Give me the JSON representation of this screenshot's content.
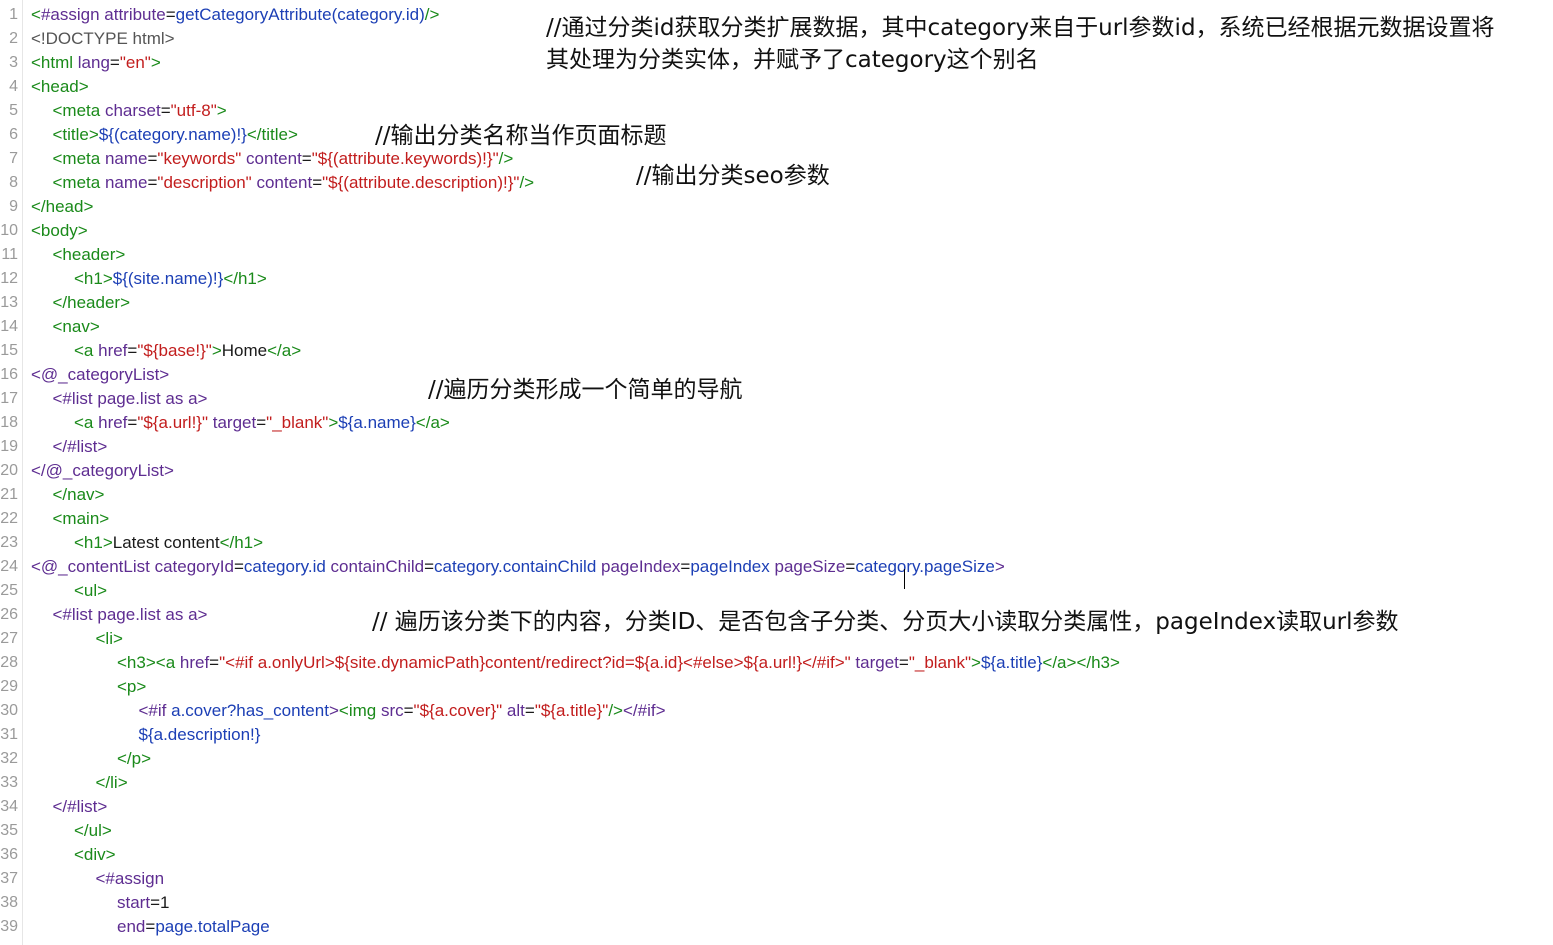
{
  "editor": {
    "lines": [
      {
        "n": "1",
        "indent": 0,
        "tokens": [
          [
            "<",
            "tag"
          ],
          [
            "#assign ",
            "attr"
          ],
          [
            "attribute",
            "attr"
          ],
          [
            "=",
            "txt"
          ],
          [
            "getCategoryAttribute(category.id)",
            "expr"
          ],
          [
            "/>",
            "tag"
          ]
        ]
      },
      {
        "n": "2",
        "indent": 0,
        "tokens": [
          [
            "<!DOCTYPE html>",
            "doc"
          ]
        ]
      },
      {
        "n": "3",
        "indent": 0,
        "tokens": [
          [
            "<html ",
            "tag"
          ],
          [
            "lang",
            "attr"
          ],
          [
            "=",
            "txt"
          ],
          [
            "\"en\"",
            "val"
          ],
          [
            ">",
            "tag"
          ]
        ]
      },
      {
        "n": "4",
        "indent": 0,
        "tokens": [
          [
            "<head>",
            "tag"
          ]
        ]
      },
      {
        "n": "5",
        "indent": 1,
        "tokens": [
          [
            "<meta ",
            "tag"
          ],
          [
            "charset",
            "attr"
          ],
          [
            "=",
            "txt"
          ],
          [
            "\"utf-8\"",
            "val"
          ],
          [
            ">",
            "tag"
          ]
        ]
      },
      {
        "n": "6",
        "indent": 1,
        "tokens": [
          [
            "<title>",
            "tag"
          ],
          [
            "${(category.name)!}",
            "expr"
          ],
          [
            "</title>",
            "tag"
          ]
        ]
      },
      {
        "n": "7",
        "indent": 1,
        "tokens": [
          [
            "<meta ",
            "tag"
          ],
          [
            "name",
            "attr"
          ],
          [
            "=",
            "txt"
          ],
          [
            "\"keywords\" ",
            "val"
          ],
          [
            "content",
            "attr"
          ],
          [
            "=",
            "txt"
          ],
          [
            "\"${(attribute.keywords)!}\"",
            "val"
          ],
          [
            "/>",
            "tag"
          ]
        ]
      },
      {
        "n": "8",
        "indent": 1,
        "tokens": [
          [
            "<meta ",
            "tag"
          ],
          [
            "name",
            "attr"
          ],
          [
            "=",
            "txt"
          ],
          [
            "\"description\" ",
            "val"
          ],
          [
            "content",
            "attr"
          ],
          [
            "=",
            "txt"
          ],
          [
            "\"${(attribute.description)!}\"",
            "val"
          ],
          [
            "/>",
            "tag"
          ]
        ]
      },
      {
        "n": "9",
        "indent": 0,
        "tokens": [
          [
            "</head>",
            "tag"
          ]
        ]
      },
      {
        "n": "10",
        "indent": 0,
        "tokens": [
          [
            "<body>",
            "tag"
          ]
        ]
      },
      {
        "n": "11",
        "indent": 1,
        "tokens": [
          [
            "<header>",
            "tag"
          ]
        ]
      },
      {
        "n": "12",
        "indent": 2,
        "tokens": [
          [
            "<h1>",
            "tag"
          ],
          [
            "${(site.name)!}",
            "expr"
          ],
          [
            "</h1>",
            "tag"
          ]
        ]
      },
      {
        "n": "13",
        "indent": 1,
        "tokens": [
          [
            "</header>",
            "tag"
          ]
        ]
      },
      {
        "n": "14",
        "indent": 1,
        "tokens": [
          [
            "<nav>",
            "tag"
          ]
        ]
      },
      {
        "n": "15",
        "indent": 2,
        "tokens": [
          [
            "<a ",
            "tag"
          ],
          [
            "href",
            "attr"
          ],
          [
            "=",
            "txt"
          ],
          [
            "\"${base!}\"",
            "val"
          ],
          [
            ">",
            "tag"
          ],
          [
            "Home",
            "txt"
          ],
          [
            "</a>",
            "tag"
          ]
        ]
      },
      {
        "n": "16",
        "indent": 0,
        "tokens": [
          [
            "<@_categoryList>",
            "attr"
          ]
        ]
      },
      {
        "n": "17",
        "indent": 1,
        "tokens": [
          [
            "<#list page.list as a>",
            "attr"
          ]
        ]
      },
      {
        "n": "18",
        "indent": 2,
        "tokens": [
          [
            "<a ",
            "tag"
          ],
          [
            "href",
            "attr"
          ],
          [
            "=",
            "txt"
          ],
          [
            "\"${a.url!}\" ",
            "val"
          ],
          [
            "target",
            "attr"
          ],
          [
            "=",
            "txt"
          ],
          [
            "\"_blank\"",
            "val"
          ],
          [
            ">",
            "tag"
          ],
          [
            "${a.name}",
            "expr"
          ],
          [
            "</a>",
            "tag"
          ]
        ]
      },
      {
        "n": "19",
        "indent": 1,
        "tokens": [
          [
            "</#list>",
            "attr"
          ]
        ]
      },
      {
        "n": "20",
        "indent": 0,
        "tokens": [
          [
            "</@_categoryList>",
            "attr"
          ]
        ]
      },
      {
        "n": "21",
        "indent": 1,
        "tokens": [
          [
            "</nav>",
            "tag"
          ]
        ]
      },
      {
        "n": "22",
        "indent": 1,
        "tokens": [
          [
            "<main>",
            "tag"
          ]
        ]
      },
      {
        "n": "23",
        "indent": 2,
        "tokens": [
          [
            "<h1>",
            "tag"
          ],
          [
            "Latest content",
            "txt"
          ],
          [
            "</h1>",
            "tag"
          ]
        ]
      },
      {
        "n": "24",
        "indent": 0,
        "tokens": [
          [
            "<@_contentList ",
            "attr"
          ],
          [
            "categoryId",
            "attr"
          ],
          [
            "=",
            "txt"
          ],
          [
            "category.id ",
            "expr"
          ],
          [
            "containChild",
            "attr"
          ],
          [
            "=",
            "txt"
          ],
          [
            "category.containChild ",
            "expr"
          ],
          [
            "pageIndex",
            "attr"
          ],
          [
            "=",
            "txt"
          ],
          [
            "pageIndex ",
            "expr"
          ],
          [
            "pageSize",
            "attr"
          ],
          [
            "=",
            "txt"
          ],
          [
            "category.pageSize",
            "expr"
          ],
          [
            ">",
            "attr"
          ]
        ]
      },
      {
        "n": "25",
        "indent": 2,
        "tokens": [
          [
            "<ul>",
            "tag"
          ]
        ]
      },
      {
        "n": "26",
        "indent": 1,
        "tokens": [
          [
            "<#list page.list as a>",
            "attr"
          ]
        ]
      },
      {
        "n": "27",
        "indent": 3,
        "tokens": [
          [
            "<li>",
            "tag"
          ]
        ]
      },
      {
        "n": "28",
        "indent": 4,
        "tokens": [
          [
            "<h3>",
            "tag"
          ],
          [
            "<a ",
            "tag"
          ],
          [
            "href",
            "attr"
          ],
          [
            "=",
            "txt"
          ],
          [
            "\"<#if a.onlyUrl>${site.dynamicPath}content/redirect?id=${a.id}<#else>${a.url!}</#if>\" ",
            "val"
          ],
          [
            "target",
            "attr"
          ],
          [
            "=",
            "txt"
          ],
          [
            "\"_blank\"",
            "val"
          ],
          [
            ">",
            "tag"
          ],
          [
            "${a.title}",
            "expr"
          ],
          [
            "</a>",
            "tag"
          ],
          [
            "</h3>",
            "tag"
          ]
        ]
      },
      {
        "n": "29",
        "indent": 4,
        "tokens": [
          [
            "<p>",
            "tag"
          ]
        ]
      },
      {
        "n": "30",
        "indent": 5,
        "tokens": [
          [
            "<#if ",
            "attr"
          ],
          [
            "a.cover?has_content",
            "expr"
          ],
          [
            ">",
            "attr"
          ],
          [
            "<img ",
            "tag"
          ],
          [
            "src",
            "attr"
          ],
          [
            "=",
            "txt"
          ],
          [
            "\"${a.cover}\" ",
            "val"
          ],
          [
            "alt",
            "attr"
          ],
          [
            "=",
            "txt"
          ],
          [
            "\"${a.title}\"",
            "val"
          ],
          [
            "/>",
            "tag"
          ],
          [
            "</#if>",
            "attr"
          ]
        ]
      },
      {
        "n": "31",
        "indent": 5,
        "tokens": [
          [
            "${a.description!}",
            "expr"
          ]
        ]
      },
      {
        "n": "32",
        "indent": 4,
        "tokens": [
          [
            "</p>",
            "tag"
          ]
        ]
      },
      {
        "n": "33",
        "indent": 3,
        "tokens": [
          [
            "</li>",
            "tag"
          ]
        ]
      },
      {
        "n": "34",
        "indent": 1,
        "tokens": [
          [
            "</#list>",
            "attr"
          ]
        ]
      },
      {
        "n": "35",
        "indent": 2,
        "tokens": [
          [
            "</ul>",
            "tag"
          ]
        ]
      },
      {
        "n": "36",
        "indent": 2,
        "tokens": [
          [
            "<div>",
            "tag"
          ]
        ]
      },
      {
        "n": "37",
        "indent": 3,
        "tokens": [
          [
            "<#assign",
            "attr"
          ]
        ]
      },
      {
        "n": "38",
        "indent": 4,
        "tokens": [
          [
            "start",
            "attr"
          ],
          [
            "=",
            "txt"
          ],
          [
            "1",
            "txt"
          ]
        ]
      },
      {
        "n": "39",
        "indent": 4,
        "tokens": [
          [
            "end",
            "attr"
          ],
          [
            "=",
            "txt"
          ],
          [
            "page.totalPage",
            "expr"
          ]
        ]
      }
    ]
  },
  "comments": {
    "c1_line1": "//通过分类id获取分类扩展数据，其中category来自于url参数id，系统已经根据元数据设置将",
    "c1_line2": "其处理为分类实体，并赋予了category这个别名",
    "c2": "//输出分类名称当作页面标题",
    "c3": "//输出分类seo参数",
    "c4": "//遍历分类形成一个简单的导航",
    "c5": "// 遍历该分类下的内容，分类ID、是否包含子分类、分页大小读取分类属性，pageIndex读取url参数"
  }
}
